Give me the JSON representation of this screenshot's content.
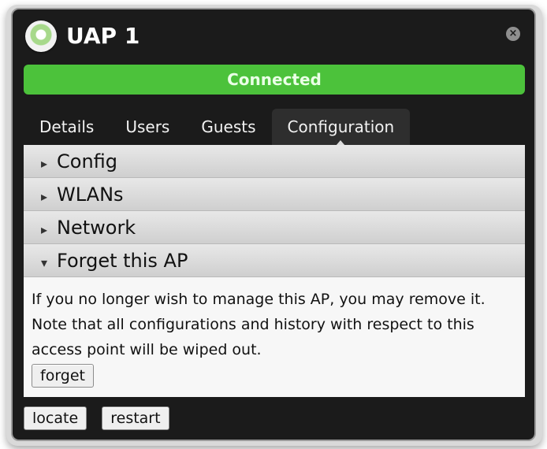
{
  "window": {
    "title": "UAP 1",
    "status": "Connected",
    "status_color": "#4cc23b"
  },
  "tabs": [
    {
      "label": "Details"
    },
    {
      "label": "Users"
    },
    {
      "label": "Guests"
    },
    {
      "label": "Configuration",
      "active": true
    }
  ],
  "sections": {
    "config": {
      "label": "Config"
    },
    "wlans": {
      "label": "WLANs"
    },
    "network": {
      "label": "Network"
    },
    "forget": {
      "label": "Forget this AP",
      "description": "If you no longer wish to manage this AP, you may remove it. Note that all configurations and history with respect to this access point will be wiped out.",
      "button": "forget"
    }
  },
  "footer": {
    "locate": "locate",
    "restart": "restart"
  },
  "icons": {
    "device": "device-status-icon",
    "close": "close-icon"
  }
}
